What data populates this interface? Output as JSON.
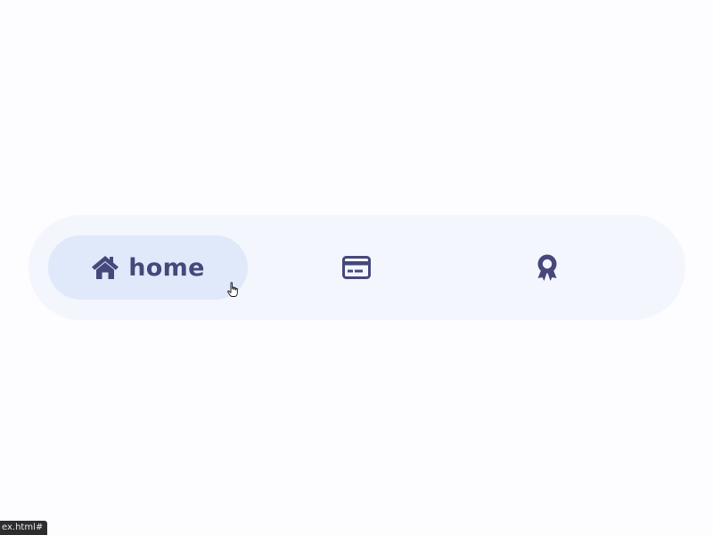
{
  "nav": {
    "items": [
      {
        "id": "home",
        "label": "home",
        "icon": "home-icon",
        "active": true
      },
      {
        "id": "card",
        "label": "",
        "icon": "credit-card-icon",
        "active": false
      },
      {
        "id": "award",
        "label": "",
        "icon": "award-icon",
        "active": false
      }
    ]
  },
  "status_bar": {
    "url": "ex.html#"
  },
  "colors": {
    "page_background": "#fdfcfe",
    "nav_background": "#f3f6fc",
    "active_pill": "#e0e9fa",
    "icon_text": "#46477b"
  }
}
